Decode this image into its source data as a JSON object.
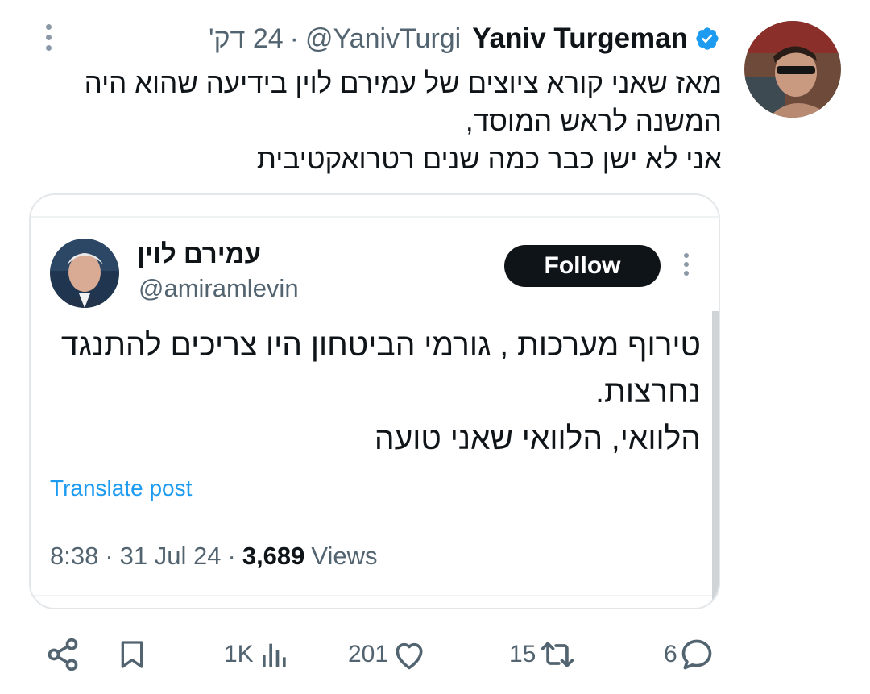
{
  "tweet": {
    "author_name": "Yaniv Turgeman",
    "handle": "@YanivTurgi",
    "separator": "·",
    "time": "24 דק'",
    "lines": [
      "מאז שאני קורא ציוצים של עמירם לוין בידיעה שהוא היה",
      "המשנה לראש המוסד,",
      "אני לא ישן כבר כמה שנים רטרואקטיבית"
    ]
  },
  "quote": {
    "author_name": "עמירם לוין",
    "handle": "@amiramlevin",
    "follow_label": "Follow",
    "lines": [
      "טירוף מערכות , גורמי הביטחון היו צריכים להתנגד",
      "נחרצות.",
      "הלוואי, הלוואי שאני טועה"
    ],
    "translate_label": "Translate post",
    "time": "8:38",
    "date": "31 Jul 24",
    "views_count": "3,689",
    "views_label": "Views"
  },
  "actions": {
    "views": "1K",
    "likes": "201",
    "retweets": "15",
    "replies": "6"
  },
  "colors": {
    "accent": "#1d9bf0",
    "text": "#0f1419",
    "muted": "#536471",
    "border": "#e3e7ea"
  },
  "icons": [
    "verified-badge-icon",
    "more-vertical-icon",
    "share-icon",
    "bookmark-icon",
    "views-icon",
    "like-icon",
    "retweet-icon",
    "reply-icon"
  ]
}
